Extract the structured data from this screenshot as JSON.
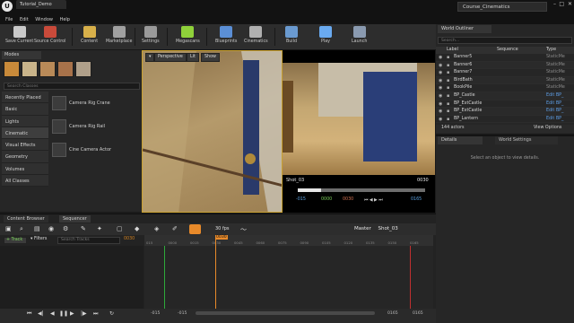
{
  "app": {
    "tab_title": "Tutorial_Demo",
    "project_name": "Course_Cinematics",
    "menu": [
      "File",
      "Edit",
      "Window",
      "Help"
    ]
  },
  "toolbar": {
    "buttons": [
      {
        "label": "Save Current",
        "icon": "save-icon",
        "color": "#c9c9c9"
      },
      {
        "label": "Source Control",
        "icon": "source-control-icon",
        "color": "#c94a3a"
      },
      {
        "label": "Content",
        "icon": "content-icon",
        "color": "#d8b04a"
      },
      {
        "label": "Marketplace",
        "icon": "marketplace-icon",
        "color": "#a0a0a0"
      },
      {
        "label": "Settings",
        "icon": "settings-icon",
        "color": "#9a9a9a"
      },
      {
        "label": "Megascans",
        "icon": "megascans-icon",
        "color": "#8fd13a"
      },
      {
        "label": "Blueprints",
        "icon": "blueprints-icon",
        "color": "#5b8fd6"
      },
      {
        "label": "Cinematics",
        "icon": "cinematics-icon",
        "color": "#b0b0b0"
      },
      {
        "label": "Build",
        "icon": "build-icon",
        "color": "#6a9ad0"
      },
      {
        "label": "Play",
        "icon": "play-icon",
        "color": "#6aaaf0"
      },
      {
        "label": "Launch",
        "icon": "launch-icon",
        "color": "#8a9ab0"
      }
    ]
  },
  "modes": {
    "tab": "Modes",
    "search_placeholder": "Search Classes",
    "categories": [
      "Recently Placed",
      "Basic",
      "Lights",
      "Cinematic",
      "Visual Effects",
      "Geometry",
      "Volumes",
      "All Classes"
    ],
    "selected_category": "Cinematic",
    "items": [
      "Camera Rig Crane",
      "Camera Rig Rail",
      "Cine Camera Actor"
    ]
  },
  "viewport": {
    "perspective": "Perspective",
    "lit": "Lit",
    "show": "Show",
    "shot_name": "Shot_03",
    "shot_frame": "0030",
    "scrub_fraction": 0.18,
    "cam_controls": {
      "start": "-015",
      "a": "0000",
      "b": "0030",
      "end": "0165"
    }
  },
  "outliner": {
    "tab": "World Outliner",
    "search_placeholder": "Search...",
    "columns": [
      "Label",
      "Sequence",
      "Type"
    ],
    "rows": [
      {
        "label": "Banner5",
        "type": "StaticMe",
        "link": false
      },
      {
        "label": "Banner6",
        "type": "StaticMe",
        "link": false
      },
      {
        "label": "Banner7",
        "type": "StaticMe",
        "link": false
      },
      {
        "label": "BirdBath",
        "type": "StaticMe",
        "link": false
      },
      {
        "label": "BookPile",
        "type": "StaticMe",
        "link": false
      },
      {
        "label": "BP_Castle",
        "type": "Edit BP_",
        "link": true
      },
      {
        "label": "BP_ExtCastle",
        "type": "Edit BP_",
        "link": true
      },
      {
        "label": "BP_ExtCastle",
        "type": "Edit BP_",
        "link": true
      },
      {
        "label": "BP_Lantern",
        "type": "Edit BP_",
        "link": true
      }
    ],
    "actor_count": "144 actors",
    "view_options": "View Options"
  },
  "details": {
    "tab": "Details",
    "world_settings_tab": "World Settings",
    "message": "Select an object to view details."
  },
  "sequencer": {
    "content_browser_tab": "Content Browser",
    "sequencer_tab": "Sequencer",
    "fps": "30 fps",
    "breadcrumb": [
      "Master",
      "Shot_03"
    ],
    "track_button": "Track",
    "filters": "Filters",
    "search_placeholder": "Search Tracks",
    "current_frame": "0030",
    "ruler_ticks": [
      "015",
      "0000",
      "0015",
      "0030",
      "0045",
      "0060",
      "0075",
      "0090",
      "0105",
      "0120",
      "0135",
      "0150",
      "0165"
    ],
    "bottom_left_a": "-015",
    "bottom_left_b": "-015",
    "bottom_right_a": "0165",
    "bottom_right_b": "0165"
  }
}
